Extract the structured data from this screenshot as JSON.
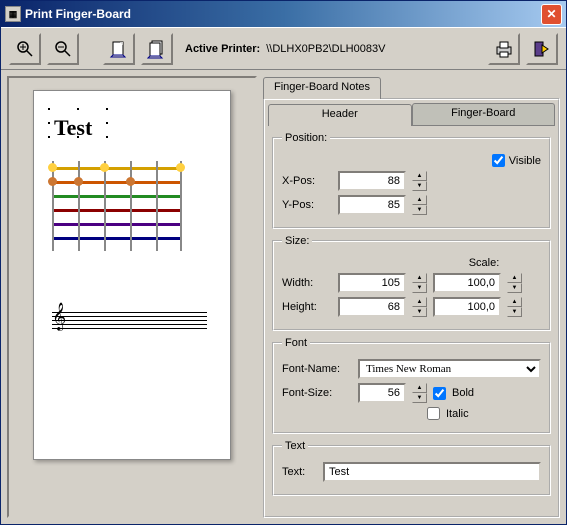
{
  "window": {
    "title": "Print Finger-Board"
  },
  "toolbar": {
    "active_printer_label": "Active Printer:",
    "active_printer_value": "\\\\DLHX0PB2\\DLH0083V"
  },
  "outer_tabs": {
    "notes": "Finger-Board Notes"
  },
  "inner_tabs": {
    "header": "Header",
    "fingerboard": "Finger-Board"
  },
  "position": {
    "legend": "Position:",
    "visible_label": "Visible",
    "visible": true,
    "xpos_label": "X-Pos:",
    "xpos": "88",
    "ypos_label": "Y-Pos:",
    "ypos": "85"
  },
  "size": {
    "legend": "Size:",
    "scale_label": "Scale:",
    "width_label": "Width:",
    "width": "105",
    "width_scale": "100,0",
    "height_label": "Height:",
    "height": "68",
    "height_scale": "100,0"
  },
  "font": {
    "legend": "Font",
    "name_label": "Font-Name:",
    "name": "Times New Roman",
    "size_label": "Font-Size:",
    "size": "56",
    "bold_label": "Bold",
    "bold": true,
    "italic_label": "Italic",
    "italic": false
  },
  "text_group": {
    "legend": "Text",
    "text_label": "Text:",
    "text_value": "Test"
  },
  "preview": {
    "title": "Test"
  }
}
